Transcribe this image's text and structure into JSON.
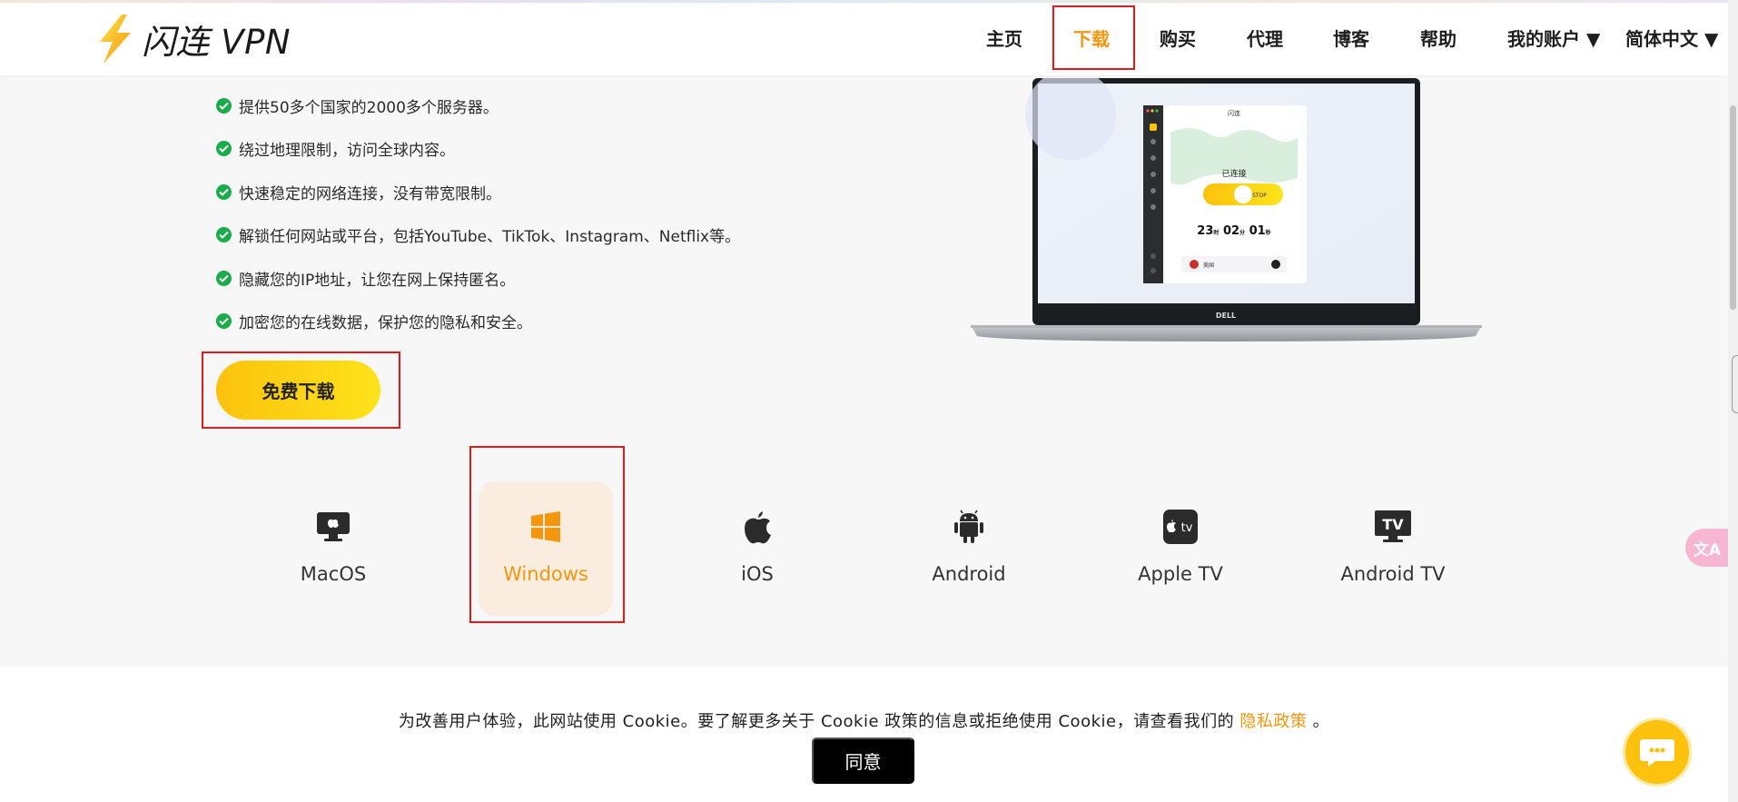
{
  "brand": {
    "name": "闪连 VPN",
    "accent": "#f4970f",
    "highlight": "#e0191d"
  },
  "nav": {
    "items": [
      {
        "label": "主页"
      },
      {
        "label": "下载",
        "active": true
      },
      {
        "label": "购买"
      },
      {
        "label": "代理"
      },
      {
        "label": "博客"
      },
      {
        "label": "帮助"
      },
      {
        "label": "我的账户 ▼"
      },
      {
        "label": "简体中文 ▼"
      }
    ]
  },
  "features": [
    "提供50多个国家的2000多个服务器。",
    "绕过地理限制，访问全球内容。",
    "快速稳定的网络连接，没有带宽限制。",
    "解锁任何网站或平台，包括YouTube、TikTok、Instagram、Netflix等。",
    "隐藏您的IP地址，让您在网上保持匿名。",
    "加密您的在线数据，保护您的隐私和安全。"
  ],
  "download_button": "免费下载",
  "app_preview": {
    "window_title": "闪连",
    "status": "已连接",
    "stop_label": "STOP",
    "timer": {
      "h": "23",
      "h_unit": "时",
      "m": "02",
      "m_unit": "分",
      "s": "01",
      "s_unit": "秒"
    },
    "location": "美国",
    "laptop_brand": "DELL"
  },
  "platforms": [
    {
      "label": "MacOS",
      "icon": "macos-monitor-icon"
    },
    {
      "label": "Windows",
      "icon": "windows-icon",
      "active": true
    },
    {
      "label": "iOS",
      "icon": "apple-icon"
    },
    {
      "label": "Android",
      "icon": "android-icon"
    },
    {
      "label": "Apple TV",
      "icon": "apple-tv-icon",
      "icon_text": "tv"
    },
    {
      "label": "Android TV",
      "icon": "android-tv-icon",
      "icon_text": "TV"
    }
  ],
  "cookie": {
    "text": "为改善用户体验，此网站使用 Cookie。要了解更多关于 Cookie 政策的信息或拒绝使用 Cookie，请查看我们的",
    "link": "隐私政策",
    "end": "。",
    "agree": "同意"
  },
  "floating": {
    "translate_label": "文A",
    "chat_icon": "chat-bubble-icon"
  }
}
